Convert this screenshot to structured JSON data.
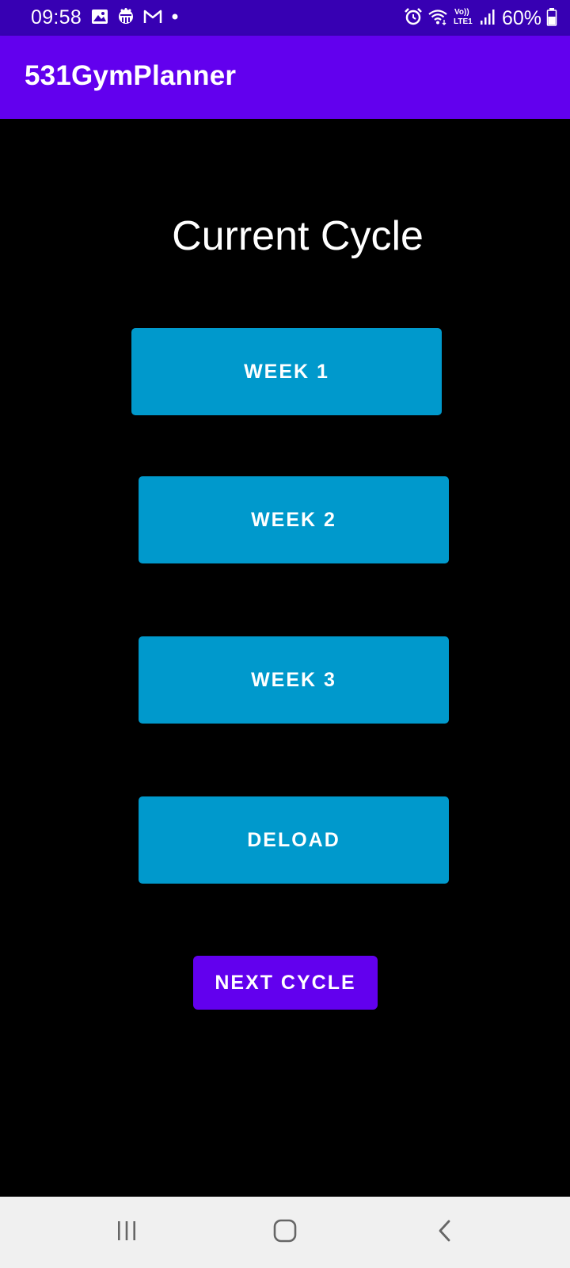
{
  "status_bar": {
    "time": "09:58",
    "battery_percent": "60%",
    "left_icons": [
      "gallery-icon",
      "app-notification-icon",
      "gmail-icon",
      "dot-icon"
    ],
    "right_icons": [
      "alarm-icon",
      "wifi-icon",
      "volte-icon",
      "signal-icon",
      "battery-icon"
    ],
    "volte_label_top": "Vo))",
    "volte_label_bottom": "LTE1",
    "background_color": "#3700b3"
  },
  "app_bar": {
    "title": "531GymPlanner",
    "background_color": "#6200ee"
  },
  "main": {
    "heading": "Current Cycle",
    "week_buttons": [
      {
        "label": "WEEK 1"
      },
      {
        "label": "WEEK 2"
      },
      {
        "label": "WEEK 3"
      },
      {
        "label": "DELOAD"
      }
    ],
    "week_button_color": "#0099cc",
    "next_cycle_label": "NEXT CYCLE",
    "next_cycle_color": "#6200ee"
  },
  "nav_bar": {
    "buttons": [
      "recents-icon",
      "home-icon",
      "back-icon"
    ],
    "background_color": "#f0f0f0"
  }
}
